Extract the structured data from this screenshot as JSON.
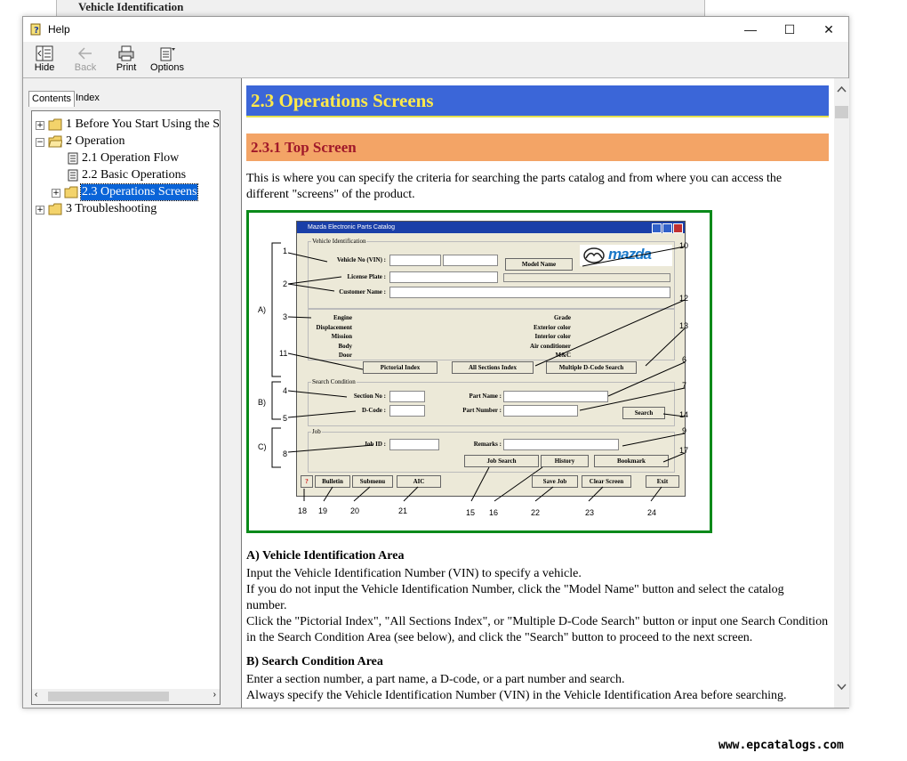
{
  "background_window": {
    "title": "Vehicle Identification"
  },
  "window": {
    "title": "Help",
    "controls": {
      "minimize": "—",
      "maximize": "☐",
      "close": "✕"
    }
  },
  "toolbar": {
    "hide": "Hide",
    "back": "Back",
    "print": "Print",
    "options": "Options"
  },
  "nav": {
    "tab_contents": "Contents",
    "tab_index": "Index"
  },
  "tree": {
    "n1": "1 Before You Start Using the S",
    "n2": "2 Operation",
    "n21": "2.1 Operation Flow",
    "n22": "2.2 Basic Operations",
    "n23": "2.3 Operations Screens",
    "n3": "3 Troubleshooting"
  },
  "article": {
    "h2": "2.3 Operations Screens",
    "h3": "2.3.1 Top Screen",
    "intro": "This is where you can specify the criteria for searching the parts catalog and from where you can access the different \"screens\" of the product.",
    "sec_a_title": "A) Vehicle Identification Area",
    "sec_a_p1": "Input the Vehicle Identification Number (VIN) to specify a vehicle.",
    "sec_a_p2": "If you do not input the Vehicle Identification Number, click the \"Model Name\" button and select the catalog number.",
    "sec_a_p3": "Click the \"Pictorial Index\", \"All Sections Index\", or \"Multiple D-Code Search\" button or input one Search Condition in the Search Condition Area (see below), and click the \"Search\" button to proceed to the next screen.",
    "sec_b_title": "B) Search Condition Area",
    "sec_b_p1": "Enter a section number, a part name, a D-code, or a part number and search.",
    "sec_b_p2": "Always specify the Vehicle Identification Number (VIN) in the Vehicle Identification Area before searching."
  },
  "figure": {
    "app_title": "Mazda Electronic Parts Catalog",
    "logo": "mazda",
    "group_vehicle": "Vehicle Identification",
    "group_search": "Search Condition",
    "group_job": "Job",
    "lbl_vin": "Vehicle No (VIN) :",
    "lbl_plate": "License Plate :",
    "lbl_customer": "Customer Name :",
    "lbl_section": "Section No :",
    "lbl_dcode": "D-Code :",
    "lbl_partname": "Part Name :",
    "lbl_partnumber": "Part Number :",
    "lbl_jobid": "Job ID :",
    "lbl_remarks": "Remarks :",
    "info_left": [
      "Engine",
      "Displacement",
      "Mission",
      "Body",
      "Door"
    ],
    "info_right": [
      "Grade",
      "Exterior color",
      "Interior color",
      "Air conditioner",
      "M&C"
    ],
    "btn_model": "Model Name",
    "btn_pictorial": "Pictorial Index",
    "btn_allsections": "All Sections Index",
    "btn_multiple": "Multiple D-Code Search",
    "btn_search": "Search",
    "btn_jobsearch": "Job Search",
    "btn_history": "History",
    "btn_bookmark": "Bookmark",
    "btn_help": "?",
    "btn_bulletin": "Bulletin",
    "btn_submenu": "Submenu",
    "btn_aic": "AIC",
    "btn_savejob": "Save Job",
    "btn_clear": "Clear Screen",
    "btn_exit": "Exit",
    "area_a": "A)",
    "area_b": "B)",
    "area_c": "C)",
    "callouts": [
      "1",
      "2",
      "3",
      "4",
      "5",
      "6",
      "7",
      "8",
      "9",
      "10",
      "11",
      "12",
      "13",
      "14",
      "15",
      "16",
      "17",
      "18",
      "19",
      "20",
      "21",
      "22",
      "23",
      "24"
    ]
  },
  "watermark": "www.epcatalogs.com"
}
